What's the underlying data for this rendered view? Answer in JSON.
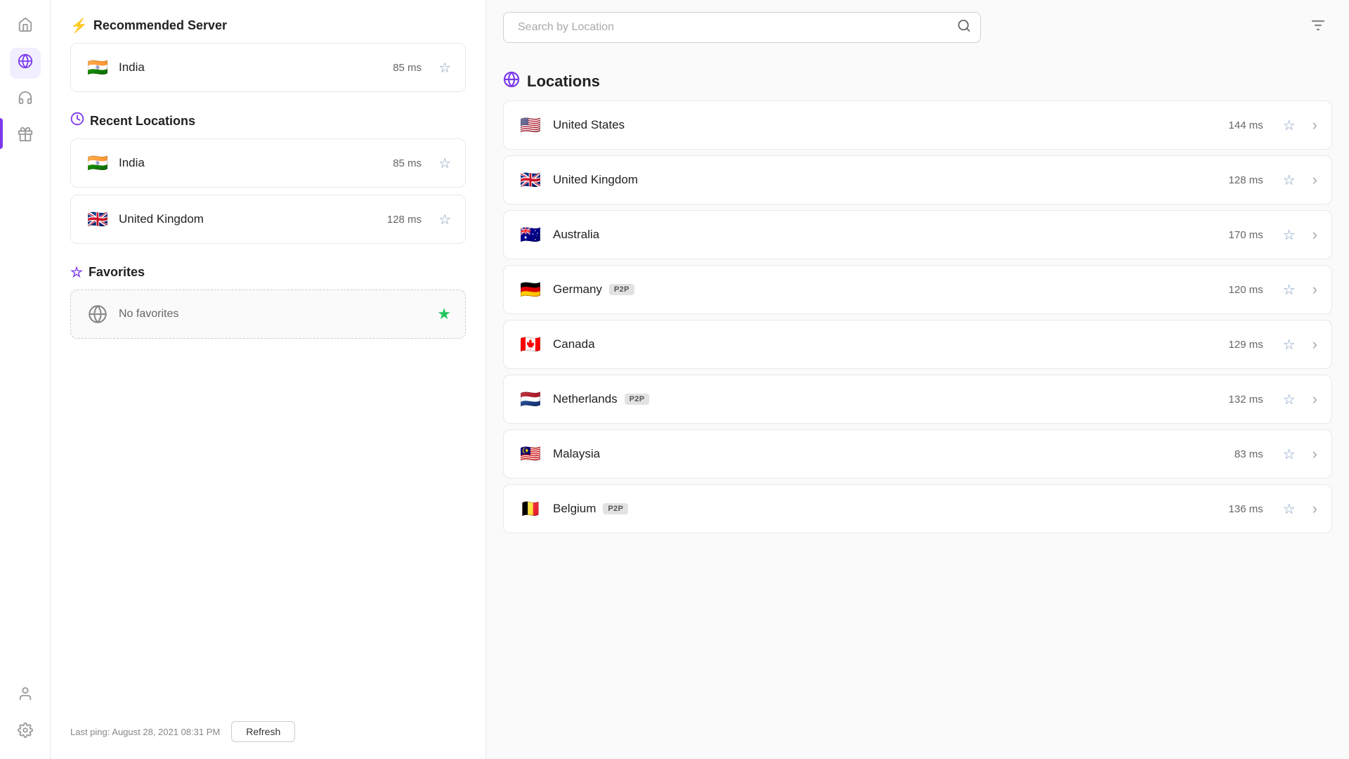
{
  "sidebar": {
    "icons": [
      {
        "name": "home-icon",
        "symbol": "⌂",
        "active": false
      },
      {
        "name": "globe-nav-icon",
        "symbol": "🌐",
        "active": true
      },
      {
        "name": "headset-icon",
        "symbol": "🎧",
        "active": false
      },
      {
        "name": "gift-icon",
        "symbol": "🎁",
        "active": false
      }
    ],
    "bottom_icons": [
      {
        "name": "user-icon",
        "symbol": "👤",
        "active": false
      },
      {
        "name": "settings-icon",
        "symbol": "⚙",
        "active": false
      }
    ]
  },
  "recommended_server": {
    "title": "Recommended Server",
    "icon": "⚡",
    "entry": {
      "country": "India",
      "flag": "🇮🇳",
      "ping": "85 ms",
      "starred": false
    }
  },
  "recent_locations": {
    "title": "Recent Locations",
    "icon": "🕐",
    "entries": [
      {
        "country": "India",
        "flag": "🇮🇳",
        "ping": "85 ms",
        "starred": false
      },
      {
        "country": "United Kingdom",
        "flag": "🇬🇧",
        "ping": "128 ms",
        "starred": false
      }
    ]
  },
  "favorites": {
    "title": "Favorites",
    "icon": "☆",
    "empty_label": "No favorites",
    "globe_icon": "🌐"
  },
  "footer": {
    "last_ping_label": "Last ping: August 28, 2021 08:31 PM",
    "refresh_label": "Refresh"
  },
  "search": {
    "placeholder": "Search by Location",
    "search_icon": "🔍"
  },
  "filter_icon": "≡",
  "locations_section": {
    "title": "Locations",
    "globe_icon": "🌐",
    "entries": [
      {
        "country": "United States",
        "flag": "🇺🇸",
        "ping": "144 ms",
        "p2p": false,
        "starred": false
      },
      {
        "country": "United Kingdom",
        "flag": "🇬🇧",
        "ping": "128 ms",
        "p2p": false,
        "starred": false
      },
      {
        "country": "Australia",
        "flag": "🇦🇺",
        "ping": "170 ms",
        "p2p": false,
        "starred": false
      },
      {
        "country": "Germany",
        "flag": "🇩🇪",
        "ping": "120 ms",
        "p2p": true,
        "starred": false
      },
      {
        "country": "Canada",
        "flag": "🇨🇦",
        "ping": "129 ms",
        "p2p": false,
        "starred": false
      },
      {
        "country": "Netherlands",
        "flag": "🇳🇱",
        "ping": "132 ms",
        "p2p": true,
        "starred": false
      },
      {
        "country": "Malaysia",
        "flag": "🇲🇾",
        "ping": "83 ms",
        "p2p": false,
        "starred": false
      },
      {
        "country": "Belgium",
        "flag": "🇧🇪",
        "ping": "136 ms",
        "p2p": true,
        "starred": false
      }
    ],
    "p2p_label": "P2P",
    "star_symbol": "☆",
    "chevron_symbol": "›"
  }
}
